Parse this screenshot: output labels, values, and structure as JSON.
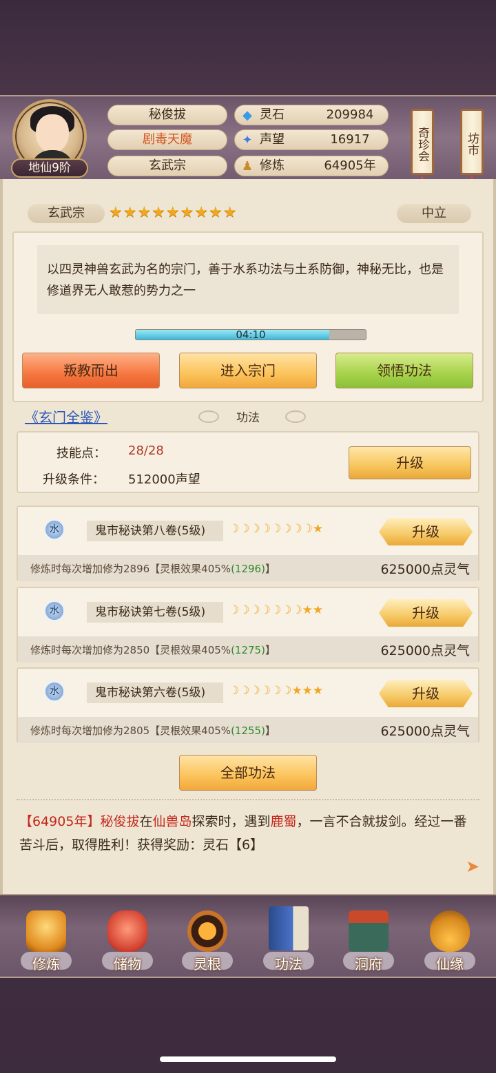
{
  "header": {
    "level": "地仙9阶",
    "name": "秘俊拔",
    "title": "剧毒天魔",
    "sect": "玄武宗",
    "resources": [
      {
        "icon": "spirit-stone-icon",
        "label": "灵石",
        "value": "209984"
      },
      {
        "icon": "reputation-icon",
        "label": "声望",
        "value": "16917"
      },
      {
        "icon": "cultivation-icon",
        "label": "修炼",
        "value": "64905年"
      }
    ],
    "side_buttons": [
      "奇珍会",
      "坊市"
    ]
  },
  "sect": {
    "name": "玄武宗",
    "stars": "★★★★★★★★★",
    "stance": "中立",
    "description": "以四灵神兽玄武为名的宗门，善于水系功法与土系防御，神秘无比，也是修道界无人敢惹的势力之一",
    "timer": "04:10",
    "timer_progress": 0.84,
    "actions": {
      "betray": "叛教而出",
      "enter": "进入宗门",
      "comprehend": "领悟功法"
    }
  },
  "gongfa": {
    "book_link": "《玄门全鉴》",
    "section_title": "功法",
    "skill_points_label": "技能点：",
    "skill_points": "28/28",
    "condition_label": "升级条件：",
    "condition": "512000声望",
    "upgrade_label": "升级",
    "items": [
      {
        "element": "水",
        "name": "鬼市秘诀第八卷(5级)",
        "moons": "☽☽☽☽☽☽☽☽★",
        "desc_pre": "修炼时每次增加修为2896【灵根效果405%",
        "desc_num": "(1296)",
        "desc_post": "】",
        "cost": "625000点灵气",
        "button": "升级"
      },
      {
        "element": "水",
        "name": "鬼市秘诀第七卷(5级)",
        "moons": "☽☽☽☽☽☽☽★★",
        "desc_pre": "修炼时每次增加修为2850【灵根效果405%",
        "desc_num": "(1275)",
        "desc_post": "】",
        "cost": "625000点灵气",
        "button": "升级"
      },
      {
        "element": "水",
        "name": "鬼市秘诀第六卷(5级)",
        "moons": "☽☽☽☽☽☽★★★",
        "desc_pre": "修炼时每次增加修为2805【灵根效果405%",
        "desc_num": "(1255)",
        "desc_post": "】",
        "cost": "625000点灵气",
        "button": "升级"
      }
    ],
    "all_button": "全部功法"
  },
  "log": {
    "year": "【64905年】",
    "name": "秘俊拔",
    "t1": "在",
    "place": "仙兽岛",
    "t2": "探索时，遇到",
    "enemy": "鹿蜀",
    "t3": "，一言不合就拔剑。经过一番苦斗后，取得胜利！获得奖励：灵石【6】"
  },
  "nav": [
    {
      "label": "修炼",
      "icon": "meditating-monk-icon"
    },
    {
      "label": "储物",
      "icon": "storage-bag-icon"
    },
    {
      "label": "灵根",
      "icon": "spirit-root-icon"
    },
    {
      "label": "功法",
      "icon": "book-icon"
    },
    {
      "label": "洞府",
      "icon": "cave-house-icon"
    },
    {
      "label": "仙缘",
      "icon": "gourd-icon"
    }
  ],
  "colors": {
    "accent_red": "#c3281c",
    "link_blue": "#2a58b8",
    "gold": "#f0a820",
    "green_value": "#2e8a2e"
  }
}
